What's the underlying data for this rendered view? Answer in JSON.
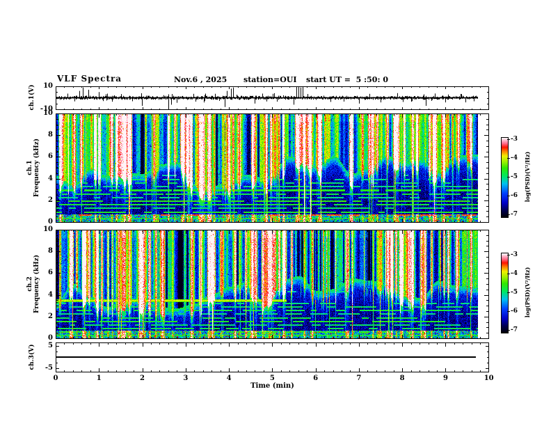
{
  "header": {
    "title": "VLF Spectra",
    "date": "Nov.6 , 2025",
    "station": "station=OUI",
    "start_ut": "start UT =  5 :50: 0"
  },
  "x_axis": {
    "label": "Time (min)",
    "ticks": [
      "0",
      "1",
      "2",
      "3",
      "4",
      "5",
      "6",
      "7",
      "8",
      "9",
      "10"
    ],
    "range": [
      0,
      10
    ],
    "minor_step": 0.2,
    "data_end_min": 9.75
  },
  "panels": {
    "wave1": {
      "ylabel": "ch.1(V)",
      "yticks": [
        "10",
        "-10"
      ],
      "yrange": [
        -10,
        10
      ]
    },
    "spec1": {
      "ch": "ch.1",
      "ylabel": "Frequency (kHz)",
      "yticks": [
        "10",
        "8",
        "6",
        "4",
        "2",
        "0"
      ],
      "yrange": [
        0,
        10
      ]
    },
    "spec2": {
      "ch": "ch.2",
      "ylabel": "Frequency (kHz)",
      "yticks": [
        "10",
        "8",
        "6",
        "4",
        "2",
        "0"
      ],
      "yrange": [
        0,
        10
      ]
    },
    "wave3": {
      "ylabel": "ch.3(V)",
      "yticks": [
        "5",
        "-5"
      ],
      "yrange": [
        -5,
        5
      ]
    }
  },
  "colorbar": {
    "label": "log(PSD)(V²/Hz)",
    "ticks": [
      "-3",
      "-4",
      "-5",
      "-6",
      "-7"
    ],
    "zrange": [
      -7,
      -3
    ],
    "gradient": [
      {
        "t": 0.0,
        "c": "#000006"
      },
      {
        "t": 0.08,
        "c": "#00004a"
      },
      {
        "t": 0.18,
        "c": "#0000c8"
      },
      {
        "t": 0.3,
        "c": "#0040ff"
      },
      {
        "t": 0.42,
        "c": "#00c0f0"
      },
      {
        "t": 0.52,
        "c": "#00e860"
      },
      {
        "t": 0.62,
        "c": "#30e800"
      },
      {
        "t": 0.7,
        "c": "#a0f000"
      },
      {
        "t": 0.77,
        "c": "#f0f000"
      },
      {
        "t": 0.83,
        "c": "#ff8000"
      },
      {
        "t": 0.88,
        "c": "#ff1400"
      },
      {
        "t": 0.93,
        "c": "#ff7090"
      },
      {
        "t": 0.97,
        "c": "#ffc0d0"
      },
      {
        "t": 1.0,
        "c": "#ffffff"
      }
    ]
  },
  "chart_data": [
    {
      "type": "line",
      "name": "ch1_waveform",
      "ylabel": "ch.1(V)",
      "ylim": [
        -10,
        10
      ],
      "xlim": [
        0,
        10
      ],
      "xlabel": "Time (min)",
      "data_end_min": 9.75,
      "signal": "broadband noise around 0 V, about +/-1.5 V, with impulsive sferic spikes",
      "spikes": [
        {
          "m": 0.55,
          "v": 6
        },
        {
          "m": 0.62,
          "v": 9
        },
        {
          "m": 0.75,
          "v": 7
        },
        {
          "m": 1.0,
          "v": 5
        },
        {
          "m": 1.99,
          "v": -7
        },
        {
          "m": 2.6,
          "v": -10
        },
        {
          "m": 2.66,
          "v": -6
        },
        {
          "m": 3.9,
          "v": -8
        },
        {
          "m": 3.95,
          "v": 6
        },
        {
          "m": 4.05,
          "v": 8
        },
        {
          "m": 4.1,
          "v": 9
        },
        {
          "m": 4.6,
          "v": -5
        },
        {
          "m": 5.5,
          "v": -6
        },
        {
          "m": 5.55,
          "v": 10
        },
        {
          "m": 5.6,
          "v": 10
        },
        {
          "m": 5.65,
          "v": 9
        },
        {
          "m": 5.7,
          "v": 10
        },
        {
          "m": 7.0,
          "v": -5
        },
        {
          "m": 8.55,
          "v": -7
        },
        {
          "m": 9.0,
          "v": -4
        }
      ],
      "seed": 11
    },
    {
      "type": "heatmap",
      "name": "ch1_spectrogram",
      "ylabel": "Frequency (kHz)",
      "ylim": [
        0,
        10
      ],
      "xlim": [
        0,
        10
      ],
      "zlabel": "log(PSD)(V²/Hz)",
      "zlim": [
        -7,
        -3
      ],
      "data_end_min": 9.75,
      "structure": {
        "description": "bright green/yellow band with red sferic streaks above ~4-6 kHz, dark blue/black below with vertical streak penetration, horizontal harmonic lines below 4.5 kHz, bright mixed band below 0.75 kHz, dark region larger after 5.3 min",
        "boundary_base_khz": 4.35,
        "boundary_right_shift_khz": 0.7,
        "right_shift_start_min": 5.3,
        "bottom_band_khz": 0.75,
        "harmonic_lines": [
          [
            0.33,
            0.55,
            0.85
          ],
          [
            0.65,
            0.86,
            0.3
          ],
          [
            0.95,
            0.58,
            0.7
          ],
          [
            1.3,
            0.52,
            0.6
          ],
          [
            1.62,
            0.56,
            0.7
          ],
          [
            1.95,
            0.6,
            0.75
          ],
          [
            2.28,
            0.5,
            0.55
          ],
          [
            2.6,
            0.55,
            0.6
          ],
          [
            2.95,
            0.58,
            0.7
          ],
          [
            3.3,
            0.5,
            0.5
          ],
          [
            3.62,
            0.52,
            0.5
          ],
          [
            3.95,
            0.5,
            0.45
          ],
          [
            4.3,
            0.48,
            0.35
          ]
        ]
      },
      "seed": 7
    },
    {
      "type": "heatmap",
      "name": "ch2_spectrogram",
      "ylabel": "Frequency (kHz)",
      "ylim": [
        0,
        10
      ],
      "xlim": [
        0,
        10
      ],
      "zlabel": "log(PSD)(V²/Hz)",
      "zlim": [
        -7,
        -3
      ],
      "data_end_min": 9.75,
      "structure": {
        "description": "similar to ch.1 with narrowband green emission line near 3.5 kHz lasting until ~5.3 min",
        "boundary_base_khz": 4.05,
        "boundary_right_shift_khz": 0.55,
        "right_shift_start_min": 5.3,
        "bottom_band_khz": 0.75,
        "harmonic_lines": [
          [
            0.3,
            0.55,
            0.8
          ],
          [
            0.62,
            0.6,
            0.6
          ],
          [
            0.95,
            0.55,
            0.6
          ],
          [
            1.28,
            0.52,
            0.55
          ],
          [
            1.6,
            0.58,
            0.65
          ],
          [
            1.92,
            0.55,
            0.6
          ],
          [
            2.25,
            0.5,
            0.5
          ],
          [
            2.58,
            0.55,
            0.6
          ],
          [
            2.9,
            0.52,
            0.55
          ],
          [
            3.22,
            0.5,
            0.5
          ],
          [
            4.35,
            0.48,
            0.4
          ]
        ]
      },
      "narrowband_emission": {
        "freq_khz": 3.5,
        "end_min": 5.33,
        "strength": 0.6
      },
      "seed": 23
    },
    {
      "type": "line",
      "name": "ch3_waveform",
      "ylabel": "ch.3(V)",
      "ylim": [
        -5,
        5
      ],
      "xlim": [
        0,
        10
      ],
      "value_constant": 0,
      "data_end_min": 9.7
    }
  ]
}
